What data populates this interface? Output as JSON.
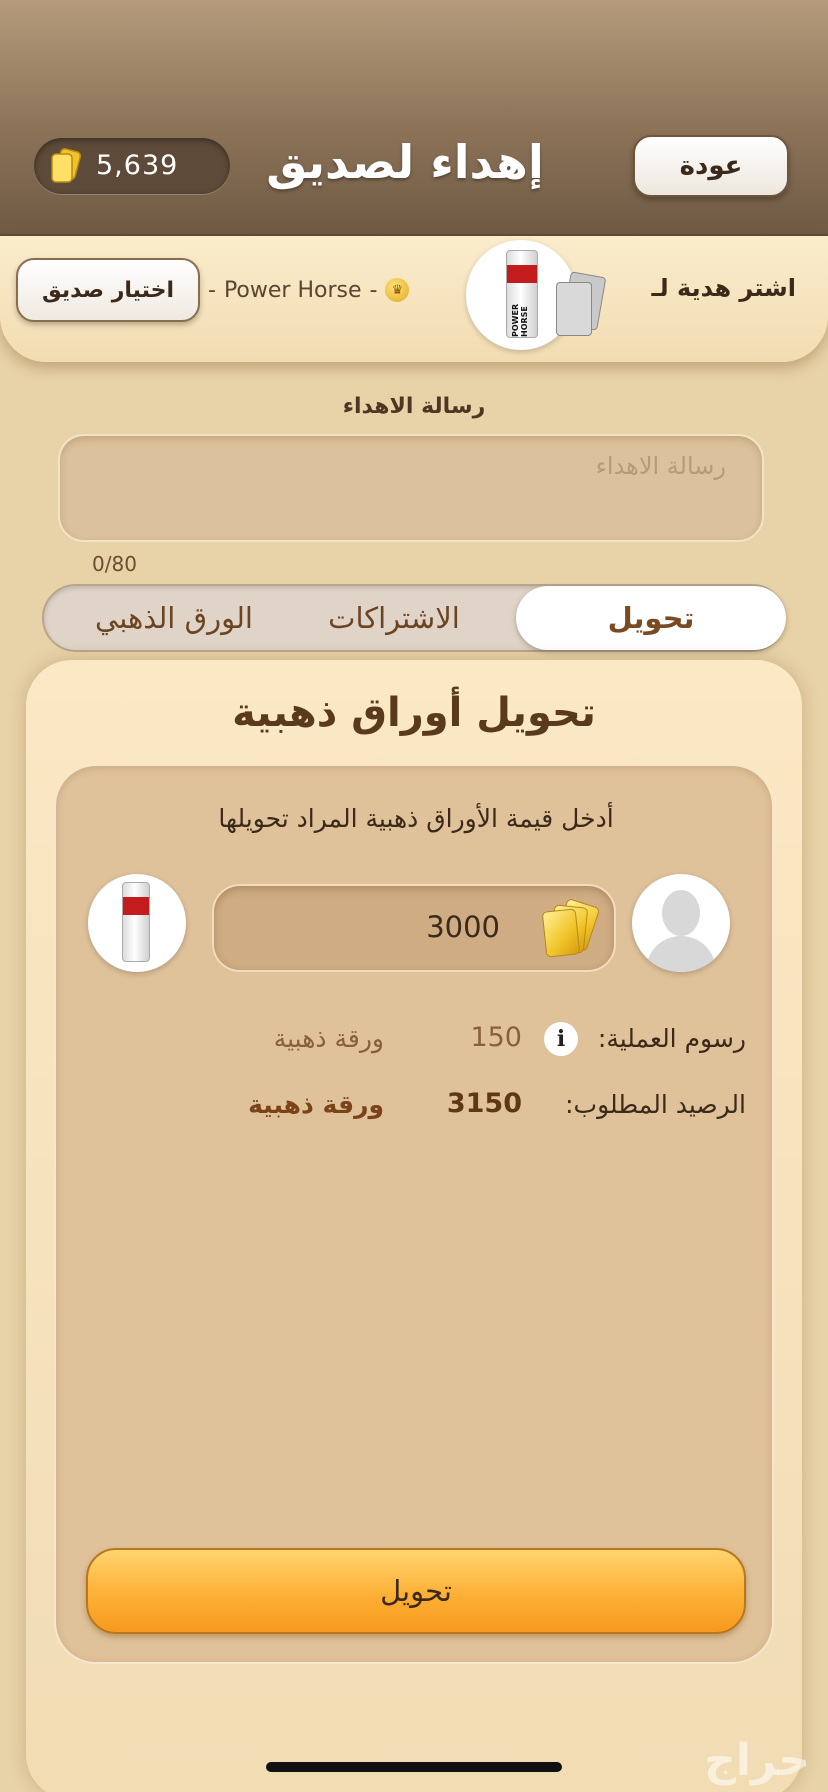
{
  "header": {
    "title": "إهداء لصديق",
    "back_label": "عودة",
    "coins_balance": "5,639"
  },
  "recipient": {
    "buy_gift_label": "اشتر هدية لـ",
    "product_name": "Power Horse",
    "separator": "-",
    "choose_friend_label": "اختيار صديق",
    "can_text": "POWER HORSE"
  },
  "message": {
    "label": "رسالة الاهداء",
    "placeholder": "رسالة الاهداء",
    "counter": "0/80"
  },
  "tabs": [
    {
      "label": "تحويل",
      "active": true
    },
    {
      "label": "الاشتراكات",
      "active": false
    },
    {
      "label": "الورق الذهبي",
      "active": false
    }
  ],
  "transfer": {
    "title": "تحويل أوراق ذهبية",
    "instruction": "أدخل قيمة الأوراق ذهبية المراد تحويلها",
    "amount": "3000",
    "fee_label": "رسوم العملية:",
    "info_glyph": "i",
    "fee_amount": "150",
    "fee_unit": "ورقة ذهبية",
    "total_label": "الرصيد المطلوب:",
    "total_amount": "3150",
    "total_unit": "ورقة ذهبية",
    "button_label": "تحويل"
  },
  "watermark": "حراج",
  "colors": {
    "header": "#8c7358",
    "panel": "#f1dcb4",
    "accent_button": "#fdb036"
  }
}
